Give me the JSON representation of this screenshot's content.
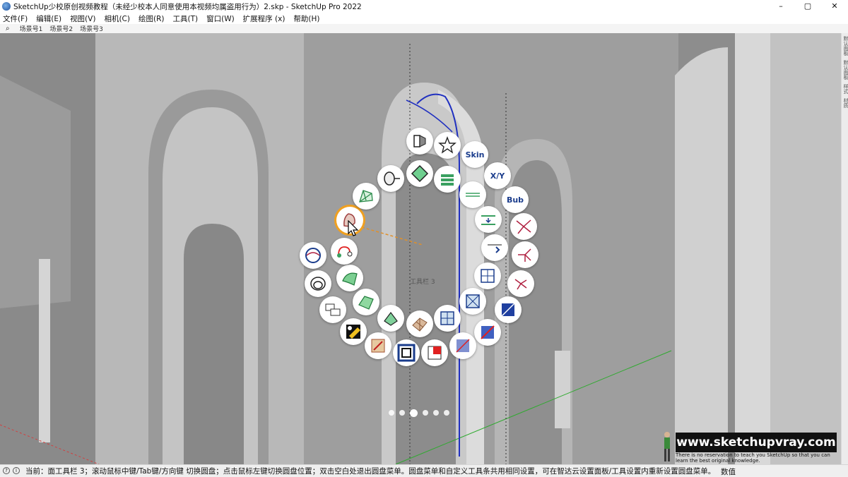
{
  "window": {
    "title": "SketchUp少校原创视频教程（未经少校本人同意使用本视频均属盗用行为）2.skp - SketchUp Pro 2022",
    "controls": [
      "–",
      "▢",
      "✕"
    ]
  },
  "menu": [
    "文件(F)",
    "编辑(E)",
    "视图(V)",
    "相机(C)",
    "绘图(R)",
    "工具(T)",
    "窗口(W)",
    "扩展程序 (x)",
    "帮助(H)"
  ],
  "scenes": [
    "场景号1",
    "场景号2",
    "场景号3"
  ],
  "side_tray": [
    "默认面板",
    "默认面板",
    "样式",
    "材质"
  ],
  "pie_menu": {
    "label": "工具栏 3",
    "skin_label": "Skin",
    "xy_label": "X/Y",
    "bub_label": "Bub",
    "page_count": 6,
    "current_page": 3
  },
  "status": {
    "text": "当前：面工具栏 3；滚动鼠标中键/Tab键/方向键 切换圆盘；点击鼠标左键切换圆盘位置；双击空白处退出圆盘菜单。圆盘菜单和自定义工具条共用相同设置，可在智达云设置面板/工具设置内重新设置圆盘菜单。",
    "value_label": "数值"
  },
  "watermark": {
    "url": "www.sketchupvray.com",
    "caption": "There is no reservation to teach you SketchUp so that you can learn the best original knowledge."
  },
  "colors": {
    "accent": "#f0a020",
    "blue_icon": "#1a3c8c",
    "sky": "#c8c8c8"
  }
}
